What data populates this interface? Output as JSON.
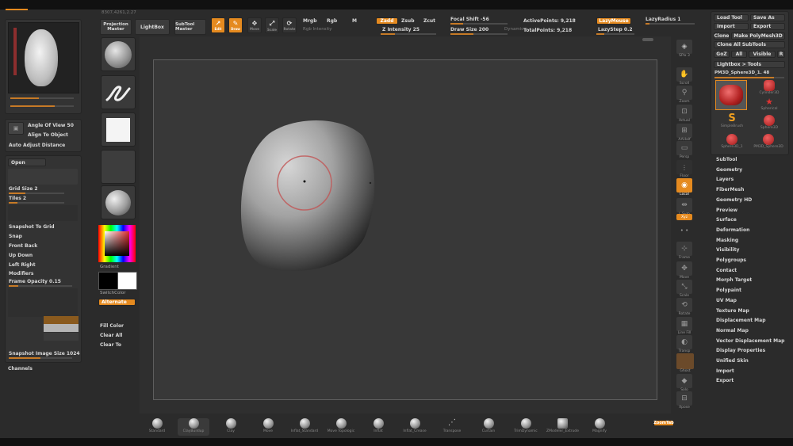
{
  "colors": {
    "accent": "#e58a1f",
    "panel": "#333333",
    "canvas": "#383838",
    "background": "#2b2b2b"
  },
  "top": {
    "coords": "8307,4261,2.27",
    "projection_master": "Projection Master",
    "lightbox": "LightBox",
    "subtool_master": "SubTool Master",
    "edit": "Edit",
    "draw": "Draw",
    "move": "Move",
    "scale": "Scale",
    "rotate": "Rotate",
    "mrgb": "Mrgb",
    "rgb": "Rgb",
    "m": "M",
    "rgb_intensity": "Rgb Intensity",
    "zadd": "Zadd",
    "zsub": "Zsub",
    "zcut": "Zcut",
    "z_intensity": "Z Intensity 25",
    "focal_shift": "Focal Shift -56",
    "draw_size": "Draw Size 200",
    "dynamic": "Dynamic",
    "active_points": "ActivePoints: 9,218",
    "total_points": "TotalPoints: 9,218",
    "lazymouse": "LazyMouse",
    "lazystep": "LazyStep 0.2",
    "lazyradius": "LazyRadius 1"
  },
  "left_tray": {
    "angle_of_view": "Angle Of View 50",
    "align_to_object": "Align To Object",
    "auto_adjust_distance": "Auto Adjust Distance",
    "open": "Open",
    "grid_size": "Grid Size 2",
    "tiles": "Tiles 2",
    "snapshot_to_grid": "Snapshot To Grid",
    "snap": "Snap",
    "front_back": "Front Back",
    "up_down": "Up Down",
    "left_right": "Left Right",
    "modifiers": "Modifiers",
    "frame_opacity": "Frame Opacity 0.15",
    "snapshot_image_size": "Snapshot Image Size 1024",
    "channels": "Channels"
  },
  "brush_column": {
    "gradient": "Gradient",
    "switchcolor": "SwitchColor",
    "alternate": "Alternate",
    "fill_color": "Fill Color",
    "clear_all": "Clear All",
    "clear_to": "Clear To"
  },
  "right_icons": [
    "SPix 3",
    "Scroll",
    "Zoom",
    "Actual",
    "AAHalf",
    "Persp",
    "Floor",
    "Local",
    "L.Sym",
    "Xyz",
    "Frame",
    "Move",
    "Scale",
    "Rotate",
    "Line Fill",
    "Transp",
    "Ghost",
    "Solo",
    "Xpose"
  ],
  "tool_panel": {
    "load_tool": "Load Tool",
    "save_as": "Save As",
    "import": "Import",
    "export": "Export",
    "clone": "Clone",
    "make_polymesh3d": "Make PolyMesh3D",
    "clone_all_subtools": "Clone All SubTools",
    "goz": "GoZ",
    "all": "All",
    "visible": "Visible",
    "r": "R",
    "lightbox_tools": "Lightbox > Tools",
    "current_tool": "PM3D_Sphere3D_1. 48",
    "tools": [
      "PolyMesh3D",
      "Cylinder3D",
      "Spherical",
      "SimpleBrush",
      "Sphere3D",
      "Sphere3D_1",
      "PM3D_Sphere3D"
    ]
  },
  "subpalettes": [
    "SubTool",
    "Geometry",
    "Layers",
    "FiberMesh",
    "Geometry HD",
    "Preview",
    "Surface",
    "Deformation",
    "Masking",
    "Visibility",
    "Polygroups",
    "Contact",
    "Morph Target",
    "Polypaint",
    "UV Map",
    "Texture Map",
    "Displacement Map",
    "Normal Map",
    "Vector Displacement Map",
    "Display Properties",
    "Unified Skin",
    "Import",
    "Export"
  ],
  "shelf": [
    "Standard",
    "ClayBuildup",
    "Clay",
    "Move",
    "Inflat_Standard",
    "Move Topologic",
    "Inflat",
    "Inflat_Crease",
    "Transpose",
    "Curtain",
    "TrimDynamic",
    "ZModeler_Extrude",
    "Magnify"
  ],
  "shelf_right": "ZoomTab"
}
